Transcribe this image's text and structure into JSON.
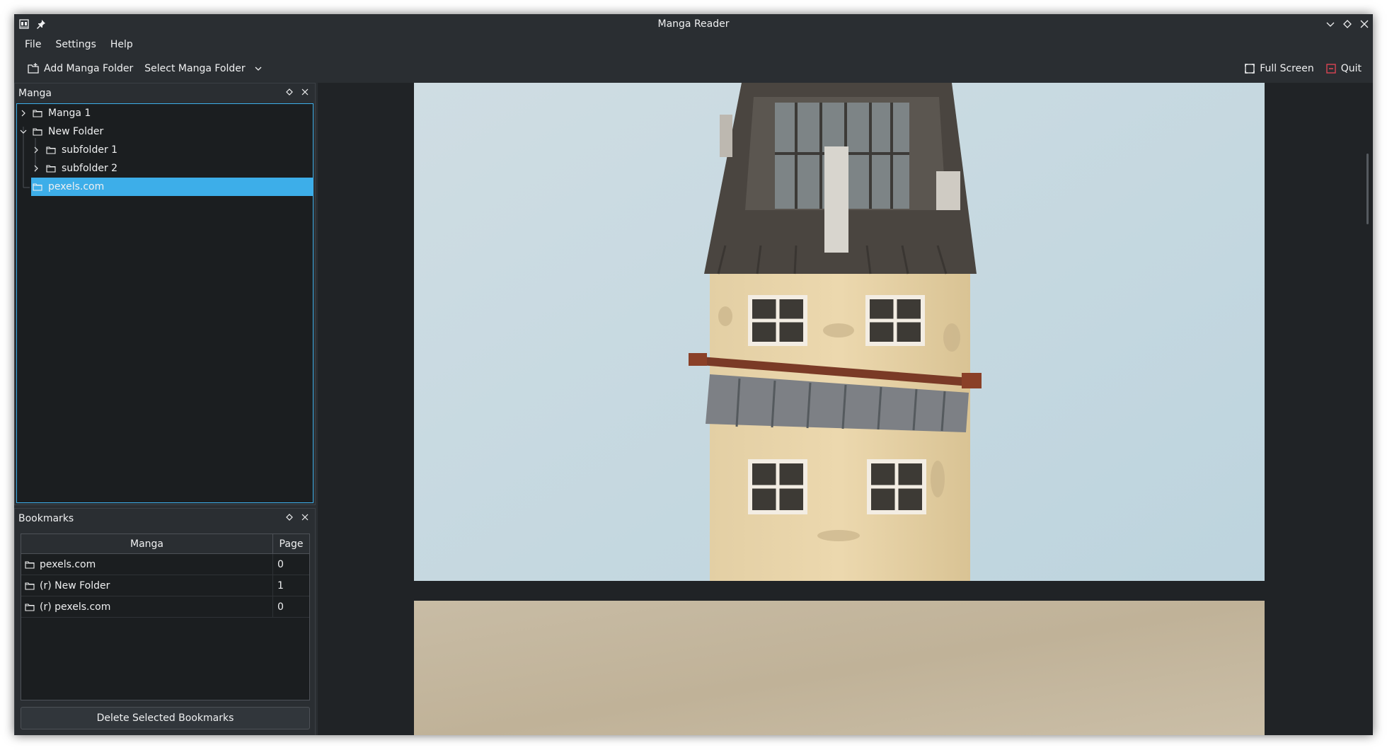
{
  "window": {
    "title": "Manga Reader"
  },
  "menubar": {
    "items": [
      "File",
      "Settings",
      "Help"
    ]
  },
  "toolbar": {
    "add_folder": "Add Manga Folder",
    "select_folder": "Select Manga Folder",
    "full_screen": "Full Screen",
    "quit": "Quit"
  },
  "manga_panel": {
    "title": "Manga",
    "tree": [
      {
        "label": "Manga 1",
        "expanded": false
      },
      {
        "label": "New Folder",
        "expanded": true
      },
      {
        "label": "subfolder 1",
        "expanded": false
      },
      {
        "label": "subfolder 2",
        "expanded": false
      },
      {
        "label": "pexels.com",
        "selected": true
      }
    ]
  },
  "bookmarks_panel": {
    "title": "Bookmarks",
    "columns": [
      "Manga",
      "Page"
    ],
    "rows": [
      {
        "manga": "pexels.com",
        "page": "0"
      },
      {
        "manga": "(r) New Folder",
        "page": "1"
      },
      {
        "manga": "(r) pexels.com",
        "page": "0"
      }
    ],
    "delete_button": "Delete Selected Bookmarks"
  },
  "colors": {
    "accent": "#3daee9",
    "window_bg": "#2a2e32",
    "view_bg": "#1b1e20",
    "quit_icon": "#da4453"
  }
}
